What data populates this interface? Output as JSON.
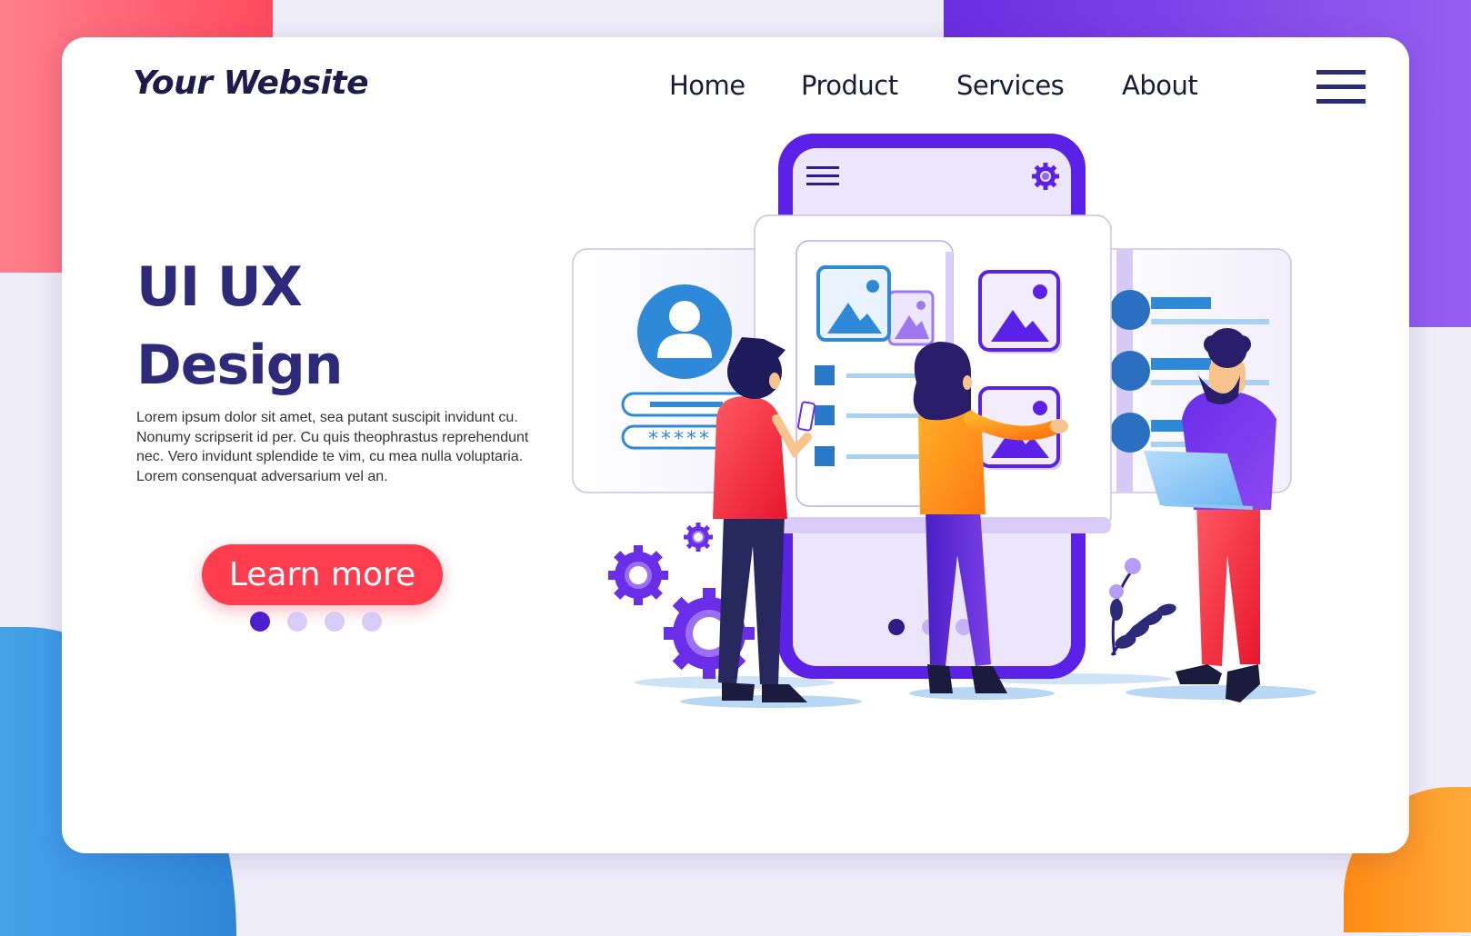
{
  "site": {
    "logo": "Your Website"
  },
  "nav": {
    "items": [
      {
        "label": "Home"
      },
      {
        "label": "Product"
      },
      {
        "label": "Services"
      },
      {
        "label": "About"
      }
    ],
    "menu_icon": "hamburger-menu-icon"
  },
  "hero": {
    "title_line1": "UI UX",
    "title_line2": "Design",
    "description": "Lorem ipsum dolor sit amet, sea putant suscipit invidunt cu. Nonumy scripserit id per. Cu quis theophrastus reprehendunt nec. Vero invidunt splendide te vim, cu mea nulla voluptaria. Lorem consenquat adversarium vel an.",
    "cta_label": "Learn more"
  },
  "carousel": {
    "total": 4,
    "active_index": 0
  },
  "illustration": {
    "subject": "Team designing a mobile app UI",
    "password_mask": "*****",
    "elements": [
      "phone-mockup",
      "login-card",
      "gallery-card",
      "list-card",
      "gears",
      "plant",
      "man-with-phone",
      "woman-pointing",
      "man-with-laptop"
    ]
  },
  "colors": {
    "primary_dark": "#2e2a7a",
    "accent_red": "#ff3d4f",
    "accent_purple": "#5b21e6",
    "accent_blue": "#2e8ad8",
    "dot_active": "#4c1fcf",
    "dot_inactive": "#d6ccf7"
  }
}
